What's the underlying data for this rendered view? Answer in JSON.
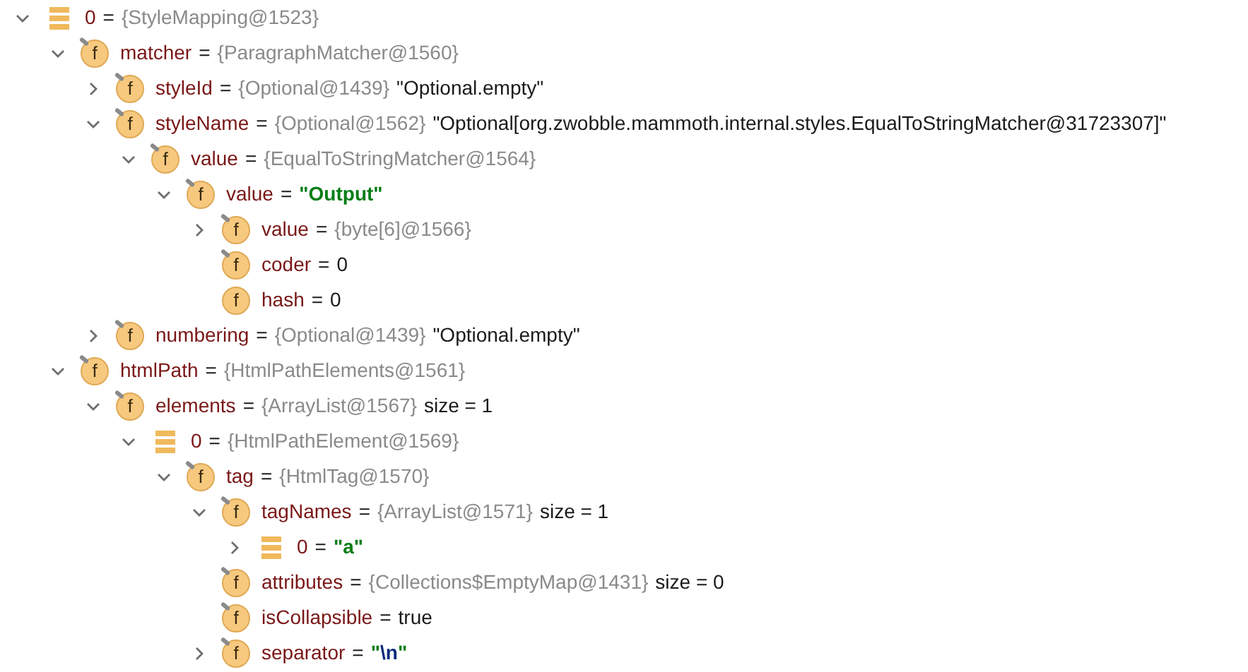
{
  "tree": [
    {
      "kind": "element",
      "name": "0",
      "sign": "=",
      "expanded": true,
      "parts": [
        {
          "kind": "type",
          "text": "{StyleMapping@1523}"
        }
      ],
      "children": [
        {
          "kind": "field",
          "badge": "f",
          "final": true,
          "name": "matcher",
          "sign": "=",
          "expanded": true,
          "parts": [
            {
              "kind": "type",
              "text": "{ParagraphMatcher@1560}"
            }
          ],
          "children": [
            {
              "kind": "field",
              "badge": "f",
              "final": true,
              "name": "styleId",
              "sign": "=",
              "expanded": false,
              "parts": [
                {
                  "kind": "type",
                  "text": "{Optional@1439}"
                },
                {
                  "kind": "text",
                  "text": "\"Optional.empty\""
                }
              ]
            },
            {
              "kind": "field",
              "badge": "f",
              "final": true,
              "name": "styleName",
              "sign": "=",
              "expanded": true,
              "parts": [
                {
                  "kind": "type",
                  "text": "{Optional@1562}"
                },
                {
                  "kind": "text",
                  "text": "\"Optional[org.zwobble.mammoth.internal.styles.EqualToStringMatcher@31723307]\""
                }
              ],
              "children": [
                {
                  "kind": "field",
                  "badge": "f",
                  "final": true,
                  "name": "value",
                  "sign": "=",
                  "expanded": true,
                  "parts": [
                    {
                      "kind": "type",
                      "text": "{EqualToStringMatcher@1564}"
                    }
                  ],
                  "children": [
                    {
                      "kind": "field",
                      "badge": "f",
                      "final": true,
                      "name": "value",
                      "sign": "=",
                      "expanded": true,
                      "parts": [
                        {
                          "kind": "string",
                          "text": "\"Output\""
                        }
                      ],
                      "children": [
                        {
                          "kind": "field",
                          "badge": "f",
                          "final": true,
                          "name": "value",
                          "sign": "=",
                          "expanded": false,
                          "parts": [
                            {
                              "kind": "type",
                              "text": "{byte[6]@1566}"
                            }
                          ]
                        },
                        {
                          "kind": "field",
                          "badge": "f",
                          "final": true,
                          "name": "coder",
                          "sign": "=",
                          "parts": [
                            {
                              "kind": "text",
                              "text": "0"
                            }
                          ]
                        },
                        {
                          "kind": "field",
                          "badge": "f",
                          "final": false,
                          "name": "hash",
                          "sign": "=",
                          "parts": [
                            {
                              "kind": "text",
                              "text": "0"
                            }
                          ]
                        }
                      ]
                    }
                  ]
                }
              ]
            },
            {
              "kind": "field",
              "badge": "f",
              "final": true,
              "name": "numbering",
              "sign": "=",
              "expanded": false,
              "parts": [
                {
                  "kind": "type",
                  "text": "{Optional@1439}"
                },
                {
                  "kind": "text",
                  "text": "\"Optional.empty\""
                }
              ]
            }
          ]
        },
        {
          "kind": "field",
          "badge": "f",
          "final": true,
          "name": "htmlPath",
          "sign": "=",
          "expanded": true,
          "parts": [
            {
              "kind": "type",
              "text": "{HtmlPathElements@1561}"
            }
          ],
          "children": [
            {
              "kind": "field",
              "badge": "f",
              "final": true,
              "name": "elements",
              "sign": "=",
              "expanded": true,
              "parts": [
                {
                  "kind": "type",
                  "text": "{ArrayList@1567}"
                },
                {
                  "kind": "text",
                  "text": "size = 1"
                }
              ],
              "children": [
                {
                  "kind": "element",
                  "name": "0",
                  "sign": "=",
                  "expanded": true,
                  "parts": [
                    {
                      "kind": "type",
                      "text": "{HtmlPathElement@1569}"
                    }
                  ],
                  "children": [
                    {
                      "kind": "field",
                      "badge": "f",
                      "final": true,
                      "name": "tag",
                      "sign": "=",
                      "expanded": true,
                      "parts": [
                        {
                          "kind": "type",
                          "text": "{HtmlTag@1570}"
                        }
                      ],
                      "children": [
                        {
                          "kind": "field",
                          "badge": "f",
                          "final": true,
                          "name": "tagNames",
                          "sign": "=",
                          "expanded": true,
                          "parts": [
                            {
                              "kind": "type",
                              "text": "{ArrayList@1571}"
                            },
                            {
                              "kind": "text",
                              "text": "size = 1"
                            }
                          ],
                          "children": [
                            {
                              "kind": "element",
                              "name": "0",
                              "sign": "=",
                              "expanded": false,
                              "parts": [
                                {
                                  "kind": "string",
                                  "text": "\"a\""
                                }
                              ]
                            }
                          ]
                        },
                        {
                          "kind": "field",
                          "badge": "f",
                          "final": true,
                          "name": "attributes",
                          "sign": "=",
                          "parts": [
                            {
                              "kind": "type",
                              "text": "{Collections$EmptyMap@1431}"
                            },
                            {
                              "kind": "text",
                              "text": "size = 0"
                            }
                          ]
                        },
                        {
                          "kind": "field",
                          "badge": "f",
                          "final": true,
                          "name": "isCollapsible",
                          "sign": "=",
                          "parts": [
                            {
                              "kind": "text",
                              "text": "true"
                            }
                          ]
                        },
                        {
                          "kind": "field",
                          "badge": "f",
                          "final": true,
                          "name": "separator",
                          "sign": "=",
                          "expanded": false,
                          "parts": [
                            {
                              "kind": "string",
                              "text": "\""
                            },
                            {
                              "kind": "escape",
                              "text": "\\n"
                            },
                            {
                              "kind": "string",
                              "text": "\""
                            }
                          ]
                        }
                      ]
                    }
                  ]
                }
              ]
            }
          ]
        }
      ]
    }
  ]
}
